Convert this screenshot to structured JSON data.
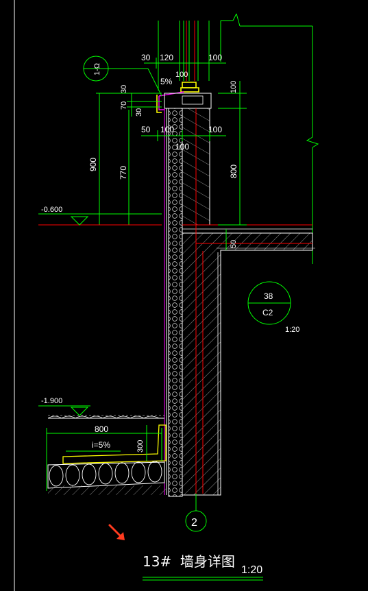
{
  "colors": {
    "background": "#000000",
    "dimension_line": "#00ff00",
    "axis_line": "#ff0000",
    "insulation": "#ffffff",
    "waterproof": "#ff00ff",
    "concrete_hatch": "#ffffff",
    "trim": "#ffff00",
    "cursor_arrow": "#ff3b1f"
  },
  "dimensions": {
    "top_30": "30",
    "top_120": "120",
    "top_100_right": "100",
    "top_100_mid": "100",
    "slope": "5%",
    "v_30_a": "30",
    "v_70": "70",
    "v_30_b": "30",
    "right_100_top": "100",
    "row_50": "50",
    "row_100_left": "100",
    "row_100_right": "100",
    "row_100_bottom": "100",
    "v_900": "900",
    "v_770": "770",
    "v_800_right": "800",
    "v_50_slab": "50",
    "footing_800": "800",
    "footing_slope": "i=5%",
    "footing_300": "300"
  },
  "elevations": {
    "upper": "-0.600",
    "lower": "-1.900"
  },
  "references": {
    "detail_callout": "1-Ω",
    "section_number": "38",
    "section_sheet": "C2",
    "section_scale": "1:20",
    "axis_number": "2"
  },
  "title": {
    "text": "13#  墙身详图",
    "scale": "1:20"
  }
}
